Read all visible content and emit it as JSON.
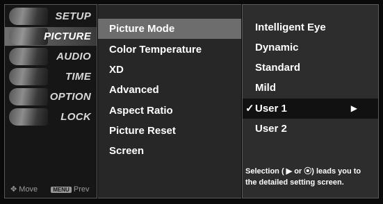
{
  "categories": [
    {
      "label": "SETUP",
      "icon": "satellite-dish-icon"
    },
    {
      "label": "PICTURE",
      "icon": "film-reel-icon"
    },
    {
      "label": "AUDIO",
      "icon": "speaker-icon"
    },
    {
      "label": "TIME",
      "icon": "clock-icon"
    },
    {
      "label": "OPTION",
      "icon": "option-disc-icon"
    },
    {
      "label": "LOCK",
      "icon": "lock-icon"
    }
  ],
  "active_category_index": 1,
  "footer": {
    "move_label": "Move",
    "menu_key": "MENU",
    "prev_label": "Prev"
  },
  "menu": {
    "items": [
      "Picture Mode",
      "Color Temperature",
      "XD",
      "Advanced",
      "Aspect Ratio",
      "Picture Reset",
      "Screen"
    ],
    "selected_index": 0
  },
  "options": {
    "items": [
      "Intelligent Eye",
      "Dynamic",
      "Standard",
      "Mild",
      "User 1",
      "User 2"
    ],
    "checked_index": 4,
    "checkmark": "✓",
    "submenu_arrow": "▶"
  },
  "hint": {
    "line1": "Selection ( ▶ or ⦿) leads you  to",
    "line2": "the detailed setting screen."
  },
  "colors": {
    "background": "#0a0a0a",
    "panel": "#272727",
    "selection": "#6d6d6d",
    "focus": "#111111",
    "text": "#ffffff"
  }
}
